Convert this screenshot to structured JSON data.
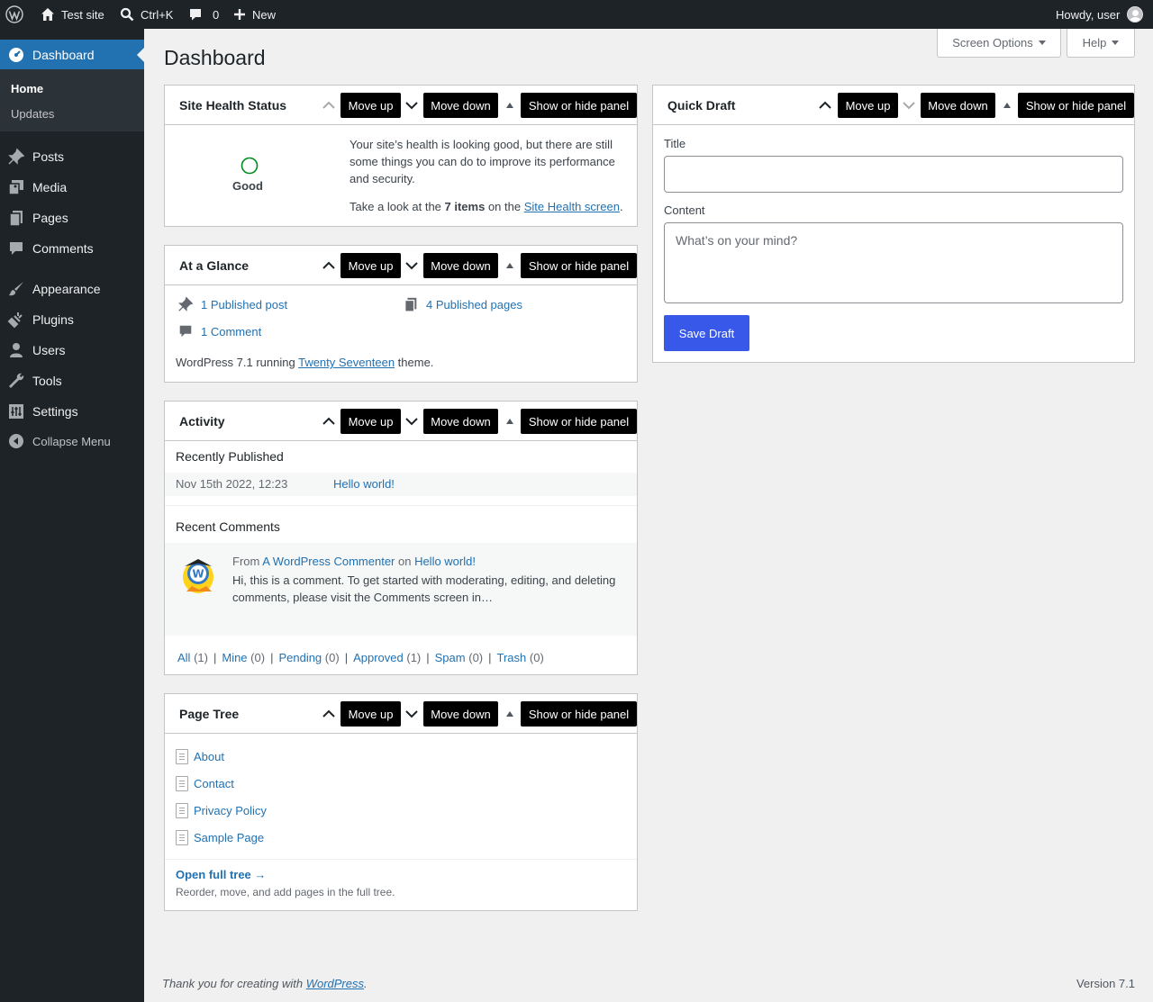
{
  "admin_bar": {
    "site_name": "Test site",
    "search_shortcut": "Ctrl+K",
    "comments_count": "0",
    "new_label": "New",
    "greeting": "Howdy, user"
  },
  "sidebar": {
    "dashboard": "Dashboard",
    "submenu": [
      "Home",
      "Updates"
    ],
    "items": [
      "Posts",
      "Media",
      "Pages",
      "Comments",
      "Appearance",
      "Plugins",
      "Users",
      "Tools",
      "Settings"
    ],
    "collapse": "Collapse Menu"
  },
  "screen_options": "Screen Options",
  "help": "Help",
  "page_title": "Dashboard",
  "controls": {
    "move_up": "Move up",
    "move_down": "Move down",
    "toggle": "Show or hide panel"
  },
  "site_health": {
    "title": "Site Health Status",
    "status": "Good",
    "message": "Your site’s health is looking good, but there are still some things you can do to improve its performance and security.",
    "look_prefix": "Take a look at the ",
    "items_count": "7 items",
    "look_middle": " on the ",
    "screen_link": "Site Health screen",
    "look_suffix": "."
  },
  "at_a_glance": {
    "title": "At a Glance",
    "posts": "1 Published post",
    "pages": "4 Published pages",
    "comments": "1 Comment",
    "version_prefix": "WordPress 7.1 running ",
    "theme": "Twenty Seventeen",
    "version_suffix": " theme."
  },
  "activity": {
    "title": "Activity",
    "recently_published": "Recently Published",
    "post_date": "Nov 15th 2022, 12:23",
    "post_title": "Hello world!",
    "recent_comments": "Recent Comments",
    "comment_from": "From ",
    "commenter": "A WordPress Commenter",
    "comment_on": " on ",
    "comment_post": "Hello world!",
    "comment_text": "Hi, this is a comment. To get started with moderating, editing, and deleting comments, please visit the Comments screen in…",
    "filters": [
      {
        "label": "All",
        "count": "(1)"
      },
      {
        "label": "Mine",
        "count": "(0)"
      },
      {
        "label": "Pending",
        "count": "(0)"
      },
      {
        "label": "Approved",
        "count": "(1)"
      },
      {
        "label": "Spam",
        "count": "(0)"
      },
      {
        "label": "Trash",
        "count": "(0)"
      }
    ]
  },
  "page_tree": {
    "title": "Page Tree",
    "pages": [
      "About",
      "Contact",
      "Privacy Policy",
      "Sample Page"
    ],
    "open_link": "Open full tree →",
    "hint": "Reorder, move, and add pages in the full tree."
  },
  "quick_draft": {
    "title": "Quick Draft",
    "title_label": "Title",
    "title_value": "",
    "content_label": "Content",
    "content_placeholder": "What’s on your mind?",
    "save": "Save Draft"
  },
  "footer": {
    "thanks_prefix": "Thank you for creating with ",
    "wp_link": "WordPress",
    "thanks_suffix": ".",
    "version": "Version 7.1"
  },
  "colors": {
    "admin_bg": "#1d2327",
    "accent": "#2271b1",
    "primary_button": "#3858e9",
    "health_good": "#008a20"
  }
}
